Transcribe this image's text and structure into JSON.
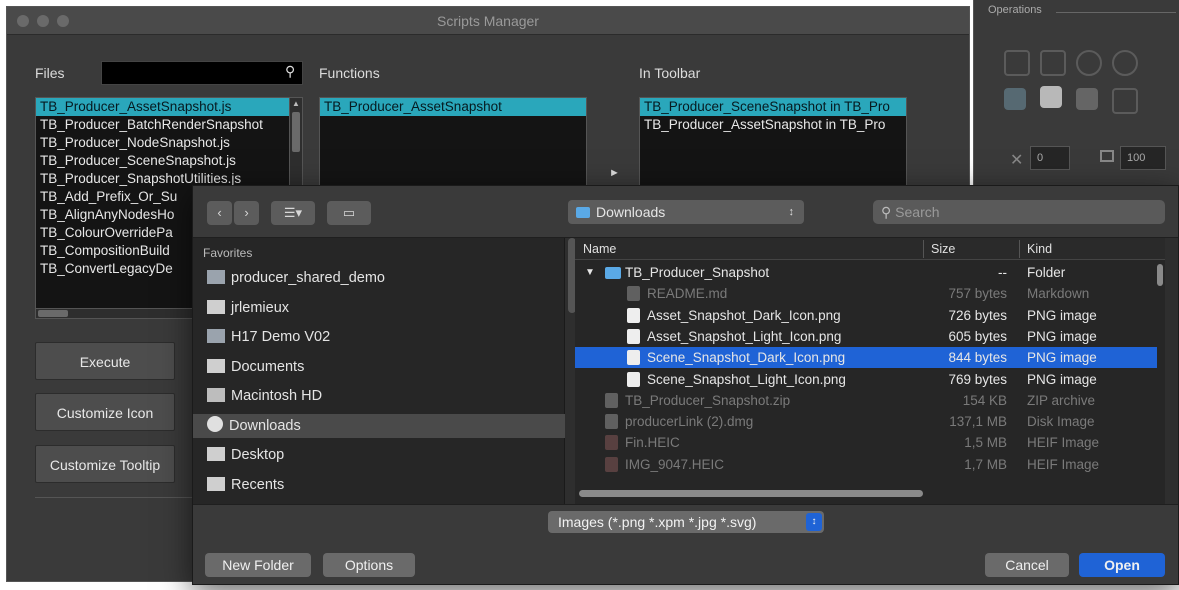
{
  "scripts_manager": {
    "title": "Scripts Manager",
    "files_label": "Files",
    "search_icon": "search-icon",
    "functions_label": "Functions",
    "in_toolbar_label": "In Toolbar",
    "files": [
      "TB_Producer_AssetSnapshot.js",
      "TB_Producer_BatchRenderSnapshot",
      "TB_Producer_NodeSnapshot.js",
      "TB_Producer_SceneSnapshot.js",
      "TB_Producer_SnapshotUtilities.js",
      "TB_Add_Prefix_Or_Su",
      "TB_AlignAnyNodesHo",
      "TB_ColourOverridePa",
      "TB_CompositionBuild",
      "TB_ConvertLegacyDe"
    ],
    "functions": [
      "TB_Producer_AssetSnapshot"
    ],
    "in_toolbar": [
      "TB_Producer_SceneSnapshot in TB_Pro",
      "TB_Producer_AssetSnapshot in TB_Pro"
    ],
    "arrow_glyph": "►",
    "buttons": {
      "execute": "Execute",
      "customize_icon": "Customize Icon",
      "customize_tooltip": "Customize Tooltip"
    }
  },
  "operations": {
    "label": "Operations",
    "field1": "0",
    "field2": "100"
  },
  "dialog": {
    "location": "Downloads",
    "search_placeholder": "Search",
    "favorites_label": "Favorites",
    "favorites": [
      {
        "label": "producer_shared_demo",
        "icon": "folder-icon"
      },
      {
        "label": "jrlemieux",
        "icon": "home-icon"
      },
      {
        "label": "H17 Demo V02",
        "icon": "folder-icon"
      },
      {
        "label": "Documents",
        "icon": "documents-icon"
      },
      {
        "label": "Macintosh HD",
        "icon": "disk-icon"
      },
      {
        "label": "Downloads",
        "icon": "downloads-icon"
      },
      {
        "label": "Desktop",
        "icon": "desktop-icon"
      },
      {
        "label": "Recents",
        "icon": "recents-icon"
      }
    ],
    "columns": {
      "name": "Name",
      "size": "Size",
      "kind": "Kind"
    },
    "files": [
      {
        "name": "TB_Producer_Snapshot",
        "size": "--",
        "kind": "Folder",
        "indent": 0,
        "enabled": true,
        "selected": false,
        "icon": "folder-icon"
      },
      {
        "name": "README.md",
        "size": "757 bytes",
        "kind": "Markdown",
        "indent": 1,
        "enabled": false,
        "selected": false,
        "icon": "document-icon"
      },
      {
        "name": "Asset_Snapshot_Dark_Icon.png",
        "size": "726 bytes",
        "kind": "PNG image",
        "indent": 1,
        "enabled": true,
        "selected": false,
        "icon": "image-icon"
      },
      {
        "name": "Asset_Snapshot_Light_Icon.png",
        "size": "605 bytes",
        "kind": "PNG image",
        "indent": 1,
        "enabled": true,
        "selected": false,
        "icon": "image-icon"
      },
      {
        "name": "Scene_Snapshot_Dark_Icon.png",
        "size": "844 bytes",
        "kind": "PNG image",
        "indent": 1,
        "enabled": true,
        "selected": true,
        "icon": "image-icon"
      },
      {
        "name": "Scene_Snapshot_Light_Icon.png",
        "size": "769 bytes",
        "kind": "PNG image",
        "indent": 1,
        "enabled": true,
        "selected": false,
        "icon": "image-icon"
      },
      {
        "name": "TB_Producer_Snapshot.zip",
        "size": "154 KB",
        "kind": "ZIP archive",
        "indent": 0,
        "enabled": false,
        "selected": false,
        "icon": "zip-icon"
      },
      {
        "name": "producerLink (2).dmg",
        "size": "137,1 MB",
        "kind": "Disk Image",
        "indent": 0,
        "enabled": false,
        "selected": false,
        "icon": "dmg-icon"
      },
      {
        "name": "Fin.HEIC",
        "size": "1,5 MB",
        "kind": "HEIF Image",
        "indent": 0,
        "enabled": false,
        "selected": false,
        "icon": "heic-icon"
      },
      {
        "name": "IMG_9047.HEIC",
        "size": "1,7 MB",
        "kind": "HEIF Image",
        "indent": 0,
        "enabled": false,
        "selected": false,
        "icon": "heic-icon"
      }
    ],
    "filter": "Images (*.png *.xpm *.jpg *.svg)",
    "buttons": {
      "new_folder": "New Folder",
      "options": "Options",
      "cancel": "Cancel",
      "open": "Open"
    },
    "colors": {
      "accent": "#1f63d6",
      "highlight": "#2aa7bb"
    }
  }
}
